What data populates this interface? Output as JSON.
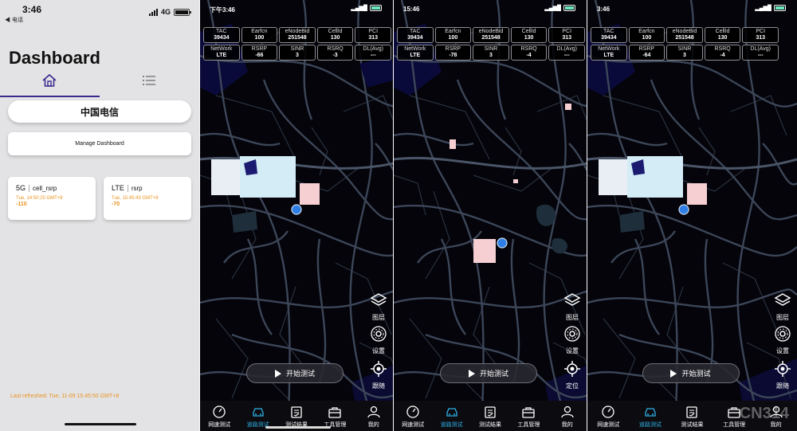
{
  "dashboard": {
    "status_time": "3:46",
    "status_back": "◀ 电话",
    "status_network": "4G",
    "title": "Dashboard",
    "operator": "中国电信",
    "manage_button": "Manage Dashboard",
    "cards": [
      {
        "tech": "5G",
        "metric": "cell_rsrp",
        "timestamp": "Tue, 14:50:25 GMT+8",
        "value": "-110"
      },
      {
        "tech": "LTE",
        "metric": "rsrp",
        "timestamp": "Tue, 15:45:43 GMT+8",
        "value": "-70"
      }
    ],
    "last_refreshed": "Last refreshed: Tue, 11-09 15:45:50 GMT+8"
  },
  "grid_keys": [
    "TAC",
    "Earfcn",
    "eNodeBid",
    "CellId",
    "PCI",
    "NetWork",
    "RSRP",
    "SINR",
    "RSRQ",
    "DL(Avg)"
  ],
  "screens": [
    {
      "status_time": "下午3:46",
      "values": [
        "39434",
        "100",
        "251548",
        "130",
        "313",
        "LTE",
        "-66",
        "3",
        "-3",
        "---"
      ],
      "side": [
        "图层",
        "设置",
        "跟随"
      ]
    },
    {
      "status_time": "15:46",
      "values": [
        "39434",
        "100",
        "251548",
        "130",
        "313",
        "LTE",
        "-78",
        "3",
        "-4",
        "---"
      ],
      "side": [
        "图层",
        "设置",
        "定位"
      ]
    },
    {
      "status_time": "3:46",
      "values": [
        "39434",
        "100",
        "251548",
        "130",
        "313",
        "LTE",
        "-64",
        "3",
        "-4",
        "---"
      ],
      "side": [
        "图层",
        "设置",
        "跟随"
      ]
    }
  ],
  "start_button": "开始测试",
  "nav": [
    "网速测试",
    "道路测试",
    "测试结果",
    "工具管理",
    "我的"
  ],
  "watermark": "CN314",
  "colors": {
    "accent": "#2fb0e6",
    "warning": "#e8921e",
    "tab_indicator": "#3b2a8e",
    "road": "#3c4658",
    "building_light": "#d4ecf6",
    "building_pink": "#f6cfd2"
  }
}
